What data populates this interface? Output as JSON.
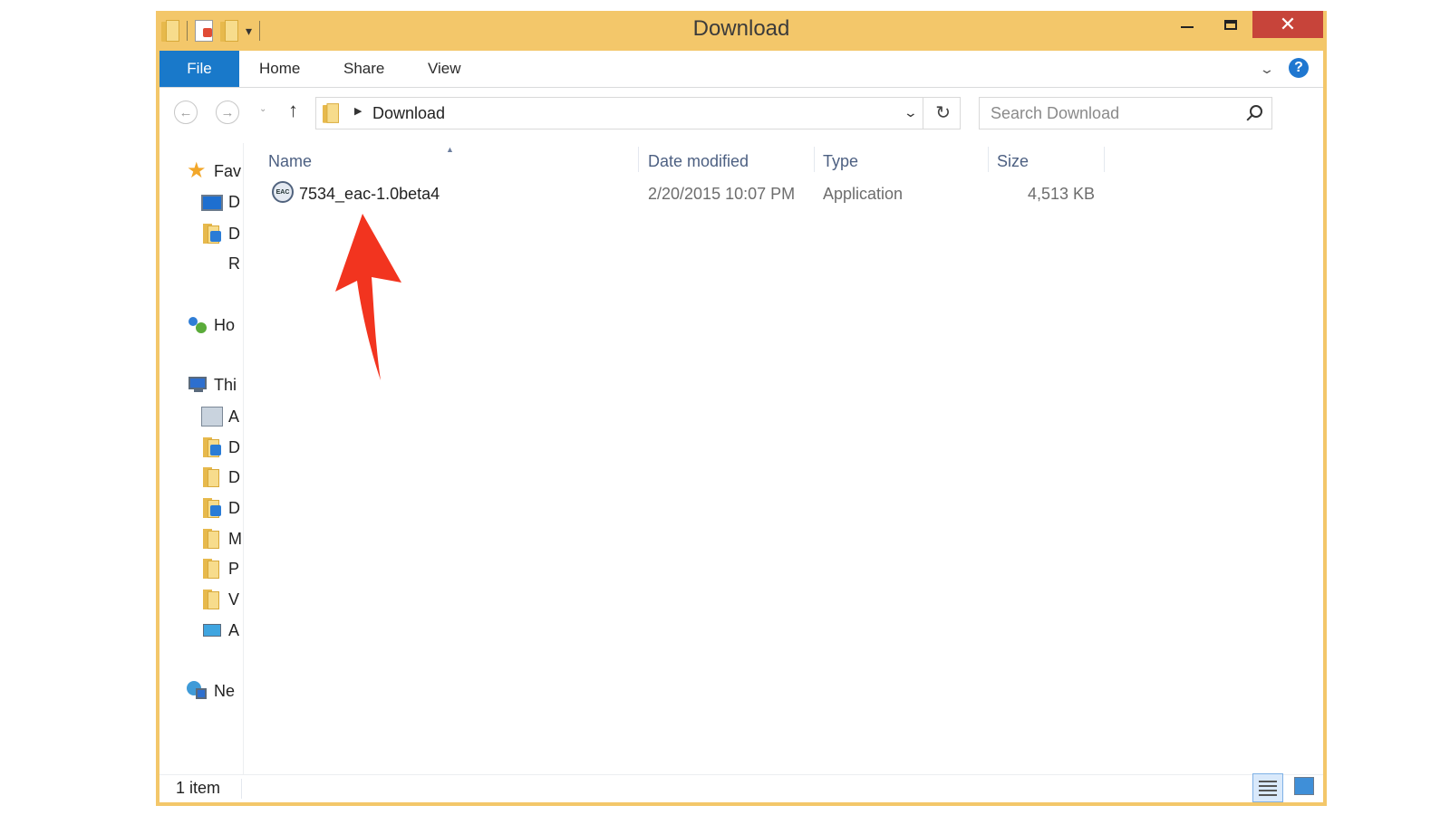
{
  "window": {
    "title": "Download"
  },
  "ribbon": {
    "file_tab": "File",
    "tabs": [
      "Home",
      "Share",
      "View"
    ],
    "help_label": "?"
  },
  "window_controls": {
    "close_label": "✕"
  },
  "nav": {
    "back_label": "←",
    "forward_label": "→",
    "recent_label": "⌄",
    "up_label": "↑",
    "address_path": "Download",
    "refresh_label": "↻",
    "search_placeholder": "Search Download"
  },
  "sidebar": {
    "items": [
      {
        "label": "Fav",
        "icon": "star-icon"
      },
      {
        "label": "D",
        "icon": "desktop-icon"
      },
      {
        "label": "D",
        "icon": "downloads-folder-icon"
      },
      {
        "label": "R",
        "icon": "recent-places-icon"
      },
      {
        "label": "Ho",
        "icon": "homegroup-icon"
      },
      {
        "label": "Thi",
        "icon": "this-pc-icon"
      },
      {
        "label": "A",
        "icon": "network-drive-icon"
      },
      {
        "label": "D",
        "icon": "desktop-folder-icon"
      },
      {
        "label": "D",
        "icon": "documents-folder-icon"
      },
      {
        "label": "D",
        "icon": "downloads-folder-icon"
      },
      {
        "label": "M",
        "icon": "music-folder-icon"
      },
      {
        "label": "P",
        "icon": "pictures-folder-icon"
      },
      {
        "label": "V",
        "icon": "videos-folder-icon"
      },
      {
        "label": "A",
        "icon": "apps-icon"
      },
      {
        "label": "Ne",
        "icon": "network-icon"
      }
    ]
  },
  "columns": [
    "Name",
    "Date modified",
    "Type",
    "Size"
  ],
  "files": [
    {
      "name": "7534_eac-1.0beta4",
      "date_modified": "2/20/2015 10:07 PM",
      "type": "Application",
      "size": "4,513 KB",
      "icon_text": "EAC"
    }
  ],
  "status": {
    "item_count": "1 item"
  },
  "colors": {
    "title_bar": "#f3c76a",
    "file_tab": "#1979ca",
    "close_button": "#c7443a",
    "annotation_arrow": "#f2341f"
  }
}
